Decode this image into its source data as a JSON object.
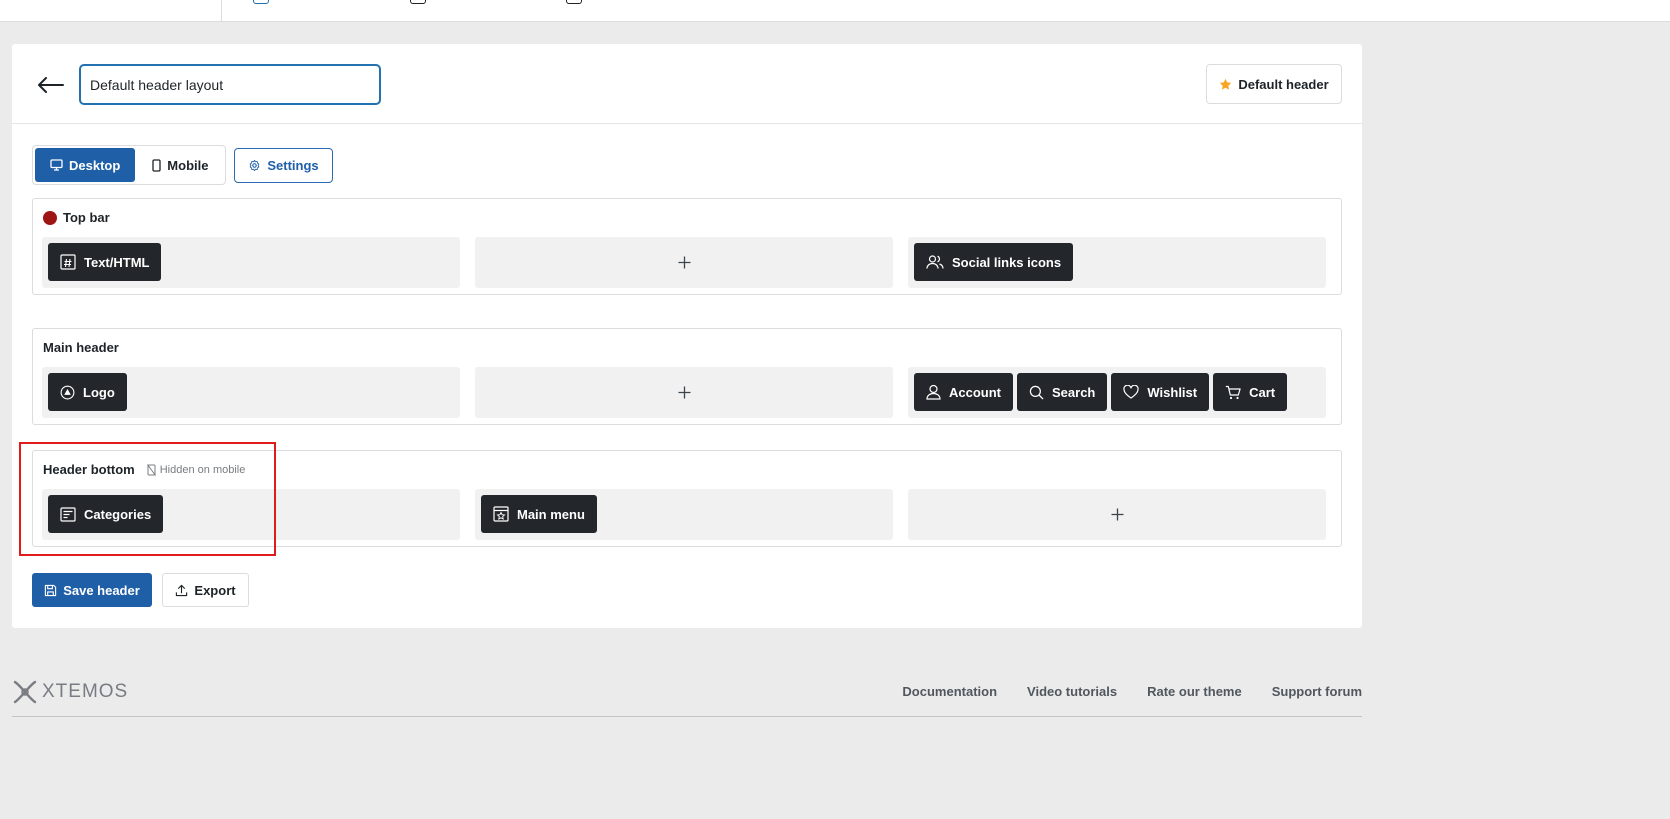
{
  "header_name_value": "Default header layout",
  "default_header_label": "Default header",
  "device_tabs": {
    "desktop": "Desktop",
    "mobile": "Mobile"
  },
  "settings_label": "Settings",
  "rows": {
    "top_bar": {
      "title": "Top bar",
      "dot_color": "#9e1515",
      "left_items": [
        "Text/HTML"
      ],
      "right_items": [
        "Social links icons"
      ]
    },
    "main_header": {
      "title": "Main header",
      "left_items": [
        "Logo"
      ],
      "right_items": [
        "Account",
        "Search",
        "Wishlist",
        "Cart"
      ]
    },
    "header_bottom": {
      "title": "Header bottom",
      "hidden_note": "Hidden on mobile",
      "left_items": [
        "Categories"
      ],
      "center_items": [
        "Main menu"
      ]
    }
  },
  "add_symbol": "+",
  "save_label": "Save header",
  "export_label": "Export",
  "footer": {
    "brand": "XTEMOS",
    "links": [
      "Documentation",
      "Video tutorials",
      "Rate our theme",
      "Support forum"
    ]
  },
  "colors": {
    "accent": "#1e5fa8",
    "chip_bg": "#23272b",
    "highlight": "#e01b1b",
    "star": "#f5a623"
  }
}
